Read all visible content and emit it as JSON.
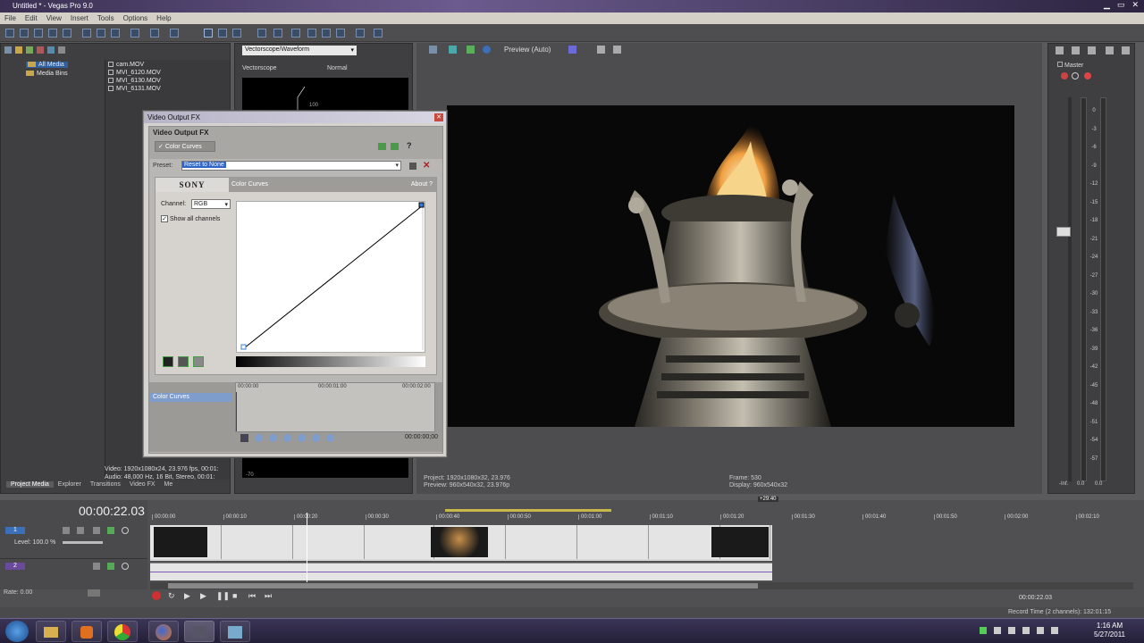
{
  "app": {
    "title": "Untitled * - Vegas Pro 9.0"
  },
  "menu": [
    "File",
    "Edit",
    "View",
    "Insert",
    "Tools",
    "Options",
    "Help"
  ],
  "explorer": {
    "tree": [
      "All Media",
      "Media Bins"
    ],
    "files": [
      "cam.MOV",
      "MVI_6120.MOV",
      "MVI_6130.MOV",
      "MVI_6131.MOV"
    ],
    "info_video": "Video: 1920x1080x24, 23.976 fps, 00:01:",
    "info_audio": "Audio: 48,000 Hz, 16 Bit, Stereo, 00:01:",
    "tabs": [
      "Project Media",
      "Explorer",
      "Transitions",
      "Video FX",
      "Me"
    ]
  },
  "scopes": {
    "dropdown": "Vectorscope/Waveform",
    "label": "Vectorscope",
    "mode": "Normal",
    "marker": "100",
    "bottom_marker": "-70"
  },
  "dialog": {
    "window_title": "Video Output FX",
    "header": "Video Output FX",
    "chain_item": "Color Curves",
    "preset_label": "Preset:",
    "preset_value": "Reset to None",
    "brand": "SONY",
    "plugin_name": "Color Curves",
    "about": "About ?",
    "channel_label": "Channel:",
    "channel_value": "RGB",
    "show_all_label": "Show all channels",
    "show_all_checked": true,
    "kf_item": "Color Curves",
    "kf_t0": "00:00:00",
    "kf_t1": "00:00:01:00",
    "kf_t2": "00:00:02:00",
    "kf_time": "00:00:00;00"
  },
  "preview": {
    "mode": "Preview (Auto)",
    "project": "Project:  1920x1080x32, 23.976",
    "preview_res": "Preview:  960x540x32, 23.976p",
    "frame": "Frame:      530",
    "display": "Display:   960x540x32"
  },
  "master": {
    "label": "Master",
    "scale": [
      "0",
      "-3",
      "-6",
      "-9",
      "-12",
      "-15",
      "-18",
      "-21",
      "-24",
      "-27",
      "-30",
      "-33",
      "-36",
      "-39",
      "-42",
      "-45",
      "-48",
      "-51",
      "-54",
      "-57"
    ],
    "left_val": "0.0",
    "right_val": "0.0",
    "bottom_left": "-Inf."
  },
  "timeline": {
    "timecode": "00:00:22.03",
    "ruler": [
      "00:00:00",
      "00:00:10",
      "00:00:20",
      "00:00:30",
      "00:00:40",
      "00:00:50",
      "00:01:00",
      "00:01:10",
      "00:01:20",
      "00:01:30",
      "00:01:40",
      "00:01:50",
      "00:02:00",
      "00:02:10"
    ],
    "video_track": "1",
    "level": "Level: 100.0 %",
    "audio_track": "2",
    "rate": "Rate: 0.00",
    "end_time": "00:00:22.03",
    "marker": "+29:40",
    "record_time": "Record Time (2 channels): 132:01:15"
  },
  "taskbar": {
    "time": "1:16 AM",
    "date": "5/27/2011"
  }
}
